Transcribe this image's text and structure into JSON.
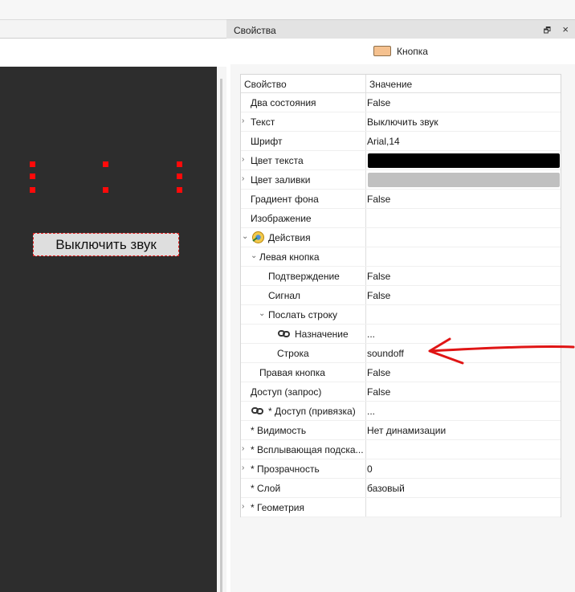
{
  "panel": {
    "title": "Свойства",
    "float_glyph": "🗗",
    "close_glyph": "×",
    "object_type": "Кнопка",
    "object_swatch_color": "#f5c18f"
  },
  "canvas": {
    "button_text": "Выключить звук",
    "background_color": "#2d2d2d"
  },
  "grid": {
    "header": {
      "name": "Свойство",
      "value": "Значение"
    },
    "rows": [
      {
        "name": "Два состояния",
        "value": "False",
        "chevron": "",
        "icon": ""
      },
      {
        "name": "Текст",
        "value": "Выключить звук",
        "chevron": "›",
        "icon": ""
      },
      {
        "name": "Шрифт",
        "value": "Arial,14",
        "chevron": "",
        "icon": ""
      },
      {
        "name": "Цвет текста",
        "value": "",
        "chevron": "›",
        "icon": "",
        "swatch": "#000000"
      },
      {
        "name": "Цвет заливки",
        "value": "",
        "chevron": "›",
        "icon": "",
        "swatch": "#c0c0c0"
      },
      {
        "name": "Градиент фона",
        "value": "False",
        "chevron": "",
        "icon": ""
      },
      {
        "name": "Изображение",
        "value": "",
        "chevron": "",
        "icon": ""
      },
      {
        "name": "Действия",
        "value": "",
        "chevron": "⌄",
        "icon": "actions-icon"
      },
      {
        "name": "Левая кнопка",
        "value": "",
        "chevron": "⌄",
        "icon": ""
      },
      {
        "name": "Подтверждение",
        "value": "False",
        "chevron": "",
        "icon": ""
      },
      {
        "name": "Сигнал",
        "value": "False",
        "chevron": "",
        "icon": ""
      },
      {
        "name": "Послать строку",
        "value": "",
        "chevron": "⌄",
        "icon": ""
      },
      {
        "name": "Назначение",
        "value": "...",
        "chevron": "",
        "icon": "link-icon"
      },
      {
        "name": "Строка",
        "value": "soundoff",
        "chevron": "",
        "icon": ""
      },
      {
        "name": "Правая кнопка",
        "value": "False",
        "chevron": "",
        "icon": ""
      },
      {
        "name": "Доступ (запрос)",
        "value": "False",
        "chevron": "",
        "icon": ""
      },
      {
        "name": "* Доступ (привязка)",
        "value": "...",
        "chevron": "",
        "icon": "link-icon"
      },
      {
        "name": "* Видимость",
        "value": "Нет динамизации",
        "chevron": "",
        "icon": ""
      },
      {
        "name": "* Всплывающая подска...",
        "value": "",
        "chevron": "›",
        "icon": ""
      },
      {
        "name": "* Прозрачность",
        "value": "0",
        "chevron": "›",
        "icon": ""
      },
      {
        "name": "* Слой",
        "value": "базовый",
        "chevron": "",
        "icon": ""
      },
      {
        "name": "* Геометрия",
        "value": "",
        "chevron": "›",
        "icon": ""
      }
    ]
  },
  "annotation": {
    "arrow_color": "#e01515"
  }
}
